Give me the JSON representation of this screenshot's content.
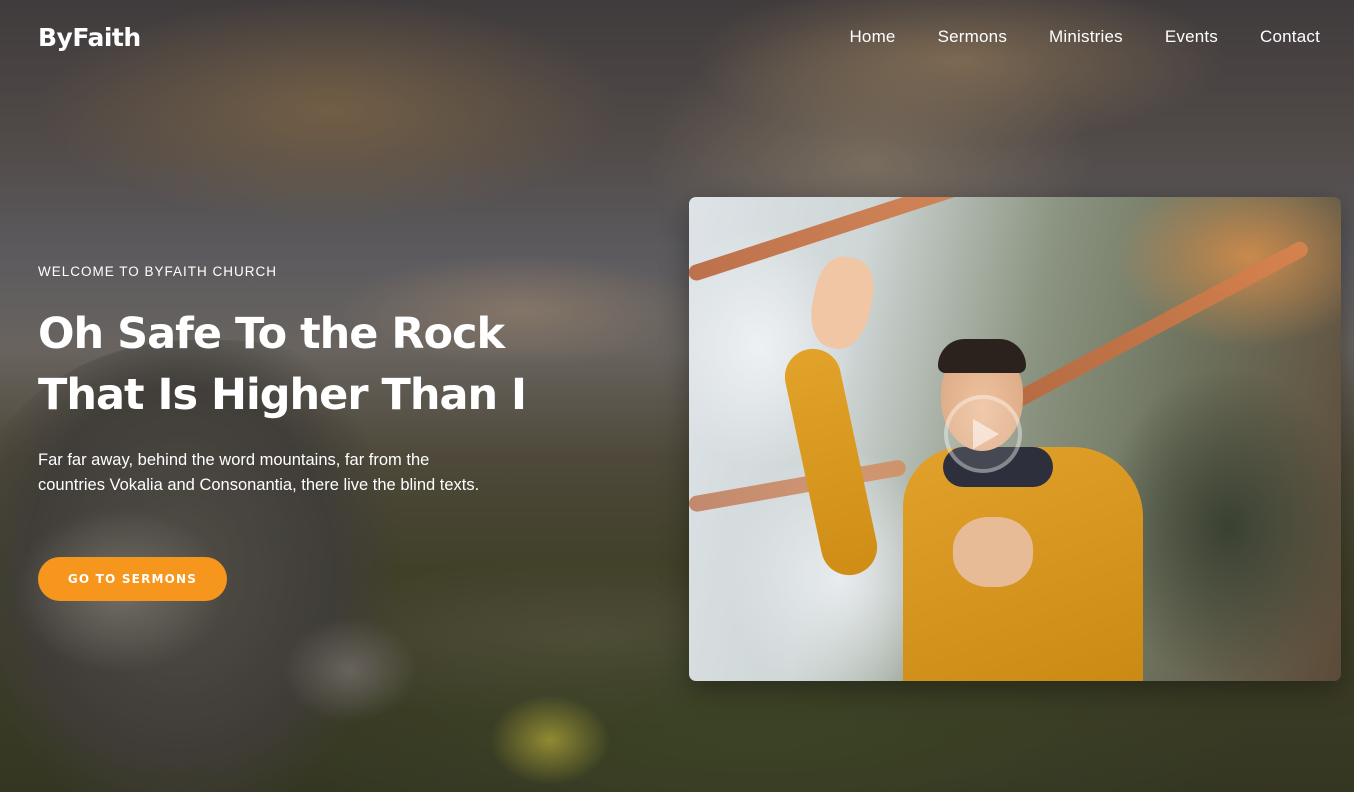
{
  "header": {
    "logo": "ByFaith",
    "nav": [
      {
        "label": "Home"
      },
      {
        "label": "Sermons"
      },
      {
        "label": "Ministries"
      },
      {
        "label": "Events"
      },
      {
        "label": "Contact"
      }
    ]
  },
  "hero": {
    "eyebrow": "WELCOME TO BYFAITH CHURCH",
    "title_line1": "Oh Safe To the Rock",
    "title_line2": "That Is Higher Than I",
    "description": "Far far away, behind the word mountains, far from the countries Vokalia and Consonantia, there live the blind texts.",
    "cta_label": "GO TO SERMONS"
  },
  "video": {
    "play_icon": "play-icon"
  },
  "colors": {
    "accent": "#f7961c",
    "text": "#ffffff"
  }
}
